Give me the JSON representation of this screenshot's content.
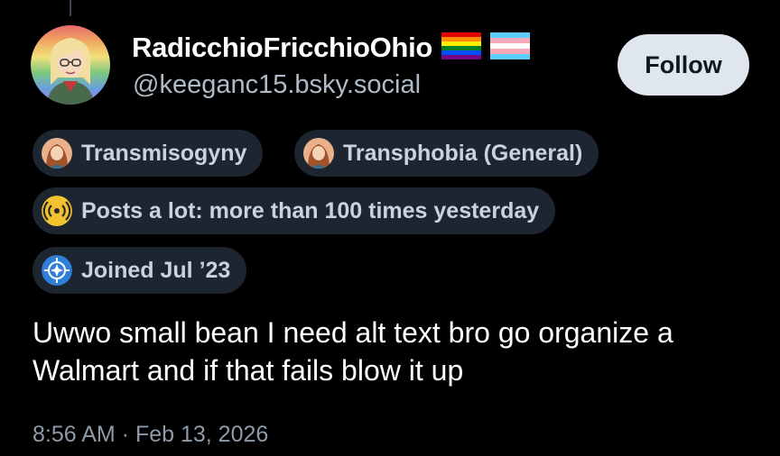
{
  "profile": {
    "display_name": "RadicchioFricchioOhio",
    "handle": "@keeganc15.bsky.social",
    "flags": [
      "rainbow-pride-flag-icon",
      "transgender-flag-icon"
    ]
  },
  "follow_label": "Follow",
  "labels": [
    {
      "text": "Transmisogyny",
      "icon": "labeler-avatar-icon"
    },
    {
      "text": "Transphobia (General)",
      "icon": "labeler-avatar-icon"
    },
    {
      "text": "Posts a lot: more than 100 times yesterday",
      "icon": "broadcast-icon"
    },
    {
      "text": "Joined Jul ’23",
      "icon": "blue-badge-icon"
    }
  ],
  "post": {
    "text": "Uwwo small bean I need alt text bro go organize a Walmart and if that fails blow it up",
    "timestamp": "8:56 AM · Feb 13, 2026"
  },
  "colors": {
    "background": "#000000",
    "pill_background": "#1d2630",
    "follow_button": "#dfe6ee",
    "handle": "#aebbc9",
    "timestamp": "#8d9aa8"
  }
}
